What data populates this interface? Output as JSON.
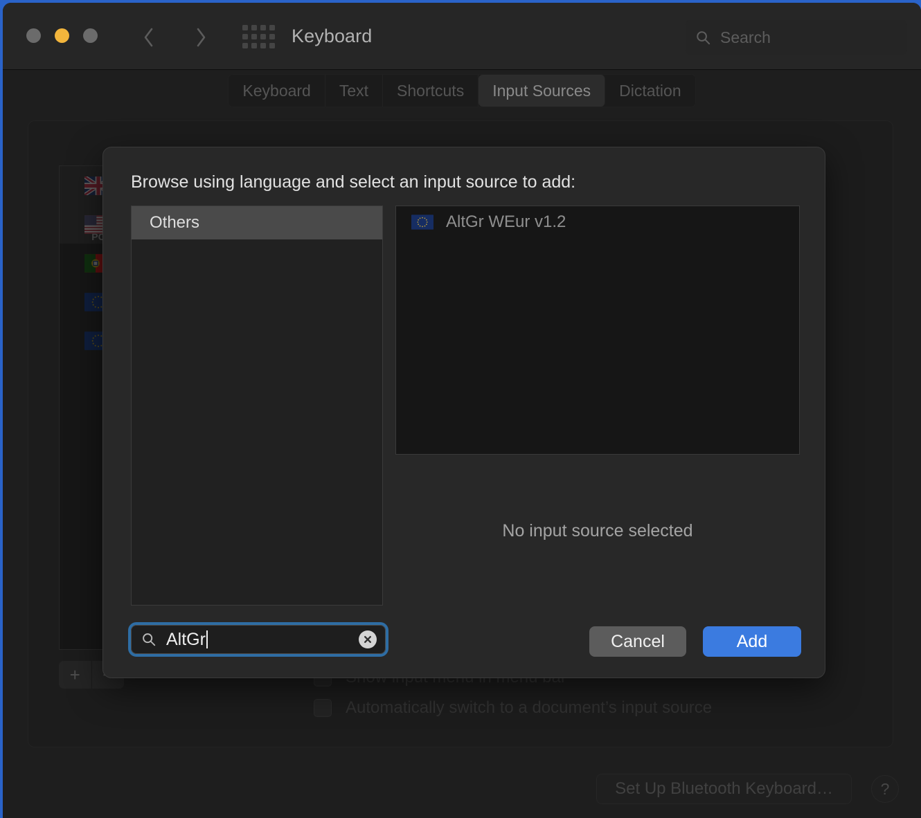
{
  "window": {
    "title": "Keyboard",
    "traffic_lights": [
      "close",
      "minimize",
      "zoom"
    ],
    "nav": {
      "back": "back-chevron",
      "forward": "forward-chevron"
    },
    "grid_icon": "show-all-grid-icon",
    "search": {
      "placeholder": "Search",
      "value": "",
      "icon": "search-icon"
    }
  },
  "tabs": [
    {
      "label": "Keyboard",
      "active": false
    },
    {
      "label": "Text",
      "active": false
    },
    {
      "label": "Shortcuts",
      "active": false
    },
    {
      "label": "Input Sources",
      "active": true
    },
    {
      "label": "Dictation",
      "active": false
    }
  ],
  "background": {
    "input_sources": [
      {
        "flag": "uk-flag-icon",
        "sub_label": "",
        "selected": true
      },
      {
        "flag": "us-flag-icon",
        "sub_label": "PC",
        "selected": true
      },
      {
        "flag": "portugal-flag-icon",
        "sub_label": "",
        "selected": false
      },
      {
        "flag": "eu-flag-icon",
        "sub_label": "",
        "selected": false
      },
      {
        "flag": "eu-flag-icon",
        "sub_label": "",
        "selected": false
      }
    ],
    "add_button": "+",
    "remove_button": "−",
    "checkboxes": [
      {
        "label": "Show input menu in menu bar",
        "checked": false
      },
      {
        "label": "Automatically switch to a document’s input source",
        "checked": false
      }
    ],
    "bluetooth_button": "Set Up Bluetooth Keyboard…",
    "help_button": "?"
  },
  "dialog": {
    "title": "Browse using language and select an input source to add:",
    "languages": [
      {
        "label": "Others",
        "selected": true
      }
    ],
    "sources": [
      {
        "label": "AltGr WEur v1.2",
        "flag": "eu-flag-icon",
        "selected": false
      }
    ],
    "empty_state": "No input source selected",
    "search": {
      "value": "AltGr",
      "placeholder": "",
      "icon": "search-icon",
      "clear_icon": "clear-icon"
    },
    "cancel_label": "Cancel",
    "add_label": "Add"
  },
  "colors": {
    "accent_blue": "#3b7be0",
    "focus_ring": "#2e6da4",
    "window_bg": "#1e1e1e",
    "dialog_bg": "#282828",
    "selection_gray": "#4a4a4a",
    "traffic_yellow": "#f2b53c"
  }
}
